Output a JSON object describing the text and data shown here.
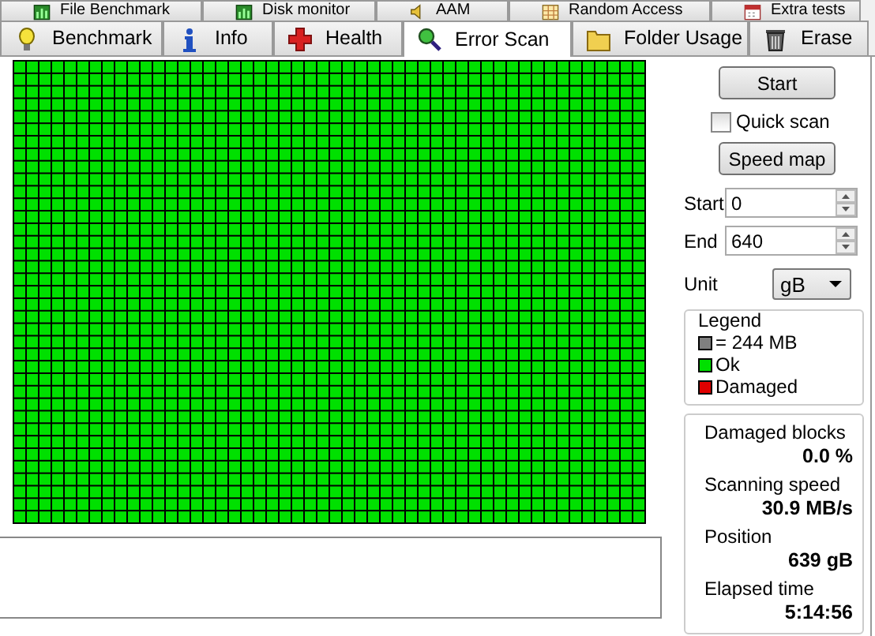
{
  "tabs_back_row": [
    {
      "label": "File Benchmark",
      "selected": false
    },
    {
      "label": "Disk monitor",
      "selected": false
    },
    {
      "label": "AAM",
      "selected": false
    },
    {
      "label": "Random Access",
      "selected": false
    },
    {
      "label": "Extra tests",
      "selected": false
    }
  ],
  "tabs_front_row": [
    {
      "label": "Benchmark",
      "selected": false
    },
    {
      "label": "Info",
      "selected": false
    },
    {
      "label": "Health",
      "selected": false
    },
    {
      "label": "Error Scan",
      "selected": true
    },
    {
      "label": "Folder Usage",
      "selected": false
    },
    {
      "label": "Erase",
      "selected": false
    }
  ],
  "controls": {
    "start_button": "Start",
    "quick_scan": {
      "label": "Quick scan",
      "checked": false
    },
    "speed_map_button": "Speed map",
    "start_field": {
      "label": "Start",
      "value": "0"
    },
    "end_field": {
      "label": "End",
      "value": "640"
    },
    "unit": {
      "label": "Unit",
      "value": "gB"
    }
  },
  "legend": {
    "title": "Legend",
    "items": [
      {
        "label": "= 244 MB",
        "color": "#808080"
      },
      {
        "label": "Ok",
        "color": "#00e000"
      },
      {
        "label": "Damaged",
        "color": "#e00000"
      }
    ]
  },
  "stats": [
    {
      "label": "Damaged blocks",
      "value": "0.0 %"
    },
    {
      "label": "Scanning speed",
      "value": "30.9 MB/s"
    },
    {
      "label": "Position",
      "value": "639 gB"
    },
    {
      "label": "Elapsed time",
      "value": "5:14:56"
    }
  ]
}
